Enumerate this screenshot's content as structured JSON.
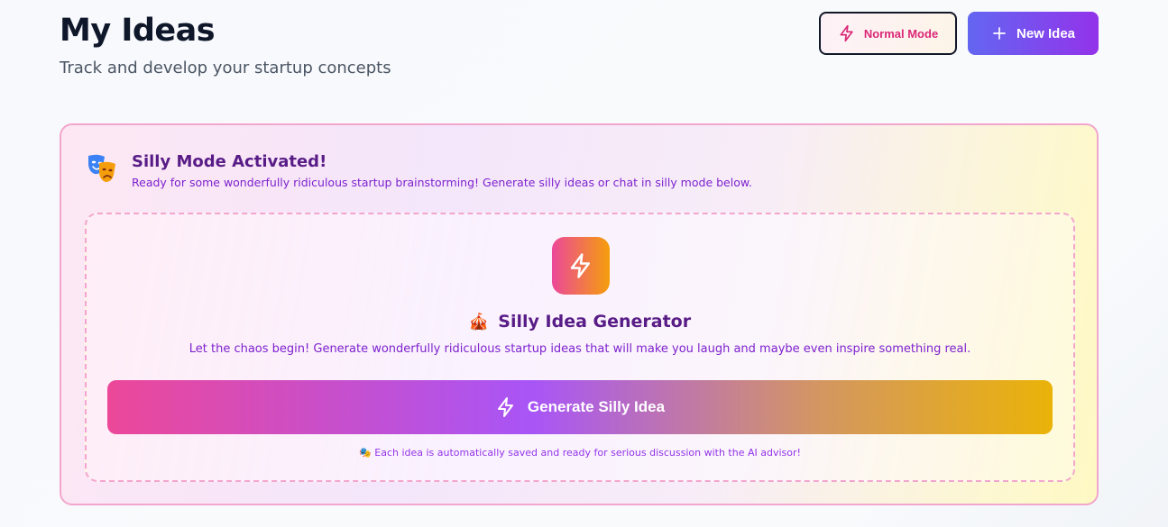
{
  "header": {
    "title": "My Ideas",
    "subtitle": "Track and develop your startup concepts",
    "mode_button": {
      "label": "Normal Mode",
      "icon": "bolt-icon"
    },
    "new_button": {
      "label": "New Idea",
      "icon": "plus-icon"
    }
  },
  "silly_banner": {
    "icon": "performing-arts-masks",
    "title": "Silly Mode Activated!",
    "description": "Ready for some wonderfully ridiculous startup brainstorming! Generate silly ideas or chat in silly mode below."
  },
  "generator": {
    "badge_icon": "bolt-icon",
    "title_emoji": "🎪",
    "title": "Silly Idea Generator",
    "description": "Let the chaos begin! Generate wonderfully ridiculous startup ideas that will make you laugh and maybe even inspire something real.",
    "button_label": "Generate Silly Idea",
    "note_emoji": "🎭",
    "note": "Each idea is automatically saved and ready for serious discussion with the AI advisor!"
  },
  "colors": {
    "accent_pink": "#ec4899",
    "accent_purple": "#9333ea",
    "accent_indigo": "#6366f1",
    "accent_yellow": "#eab308",
    "title_purple": "#581c87"
  }
}
